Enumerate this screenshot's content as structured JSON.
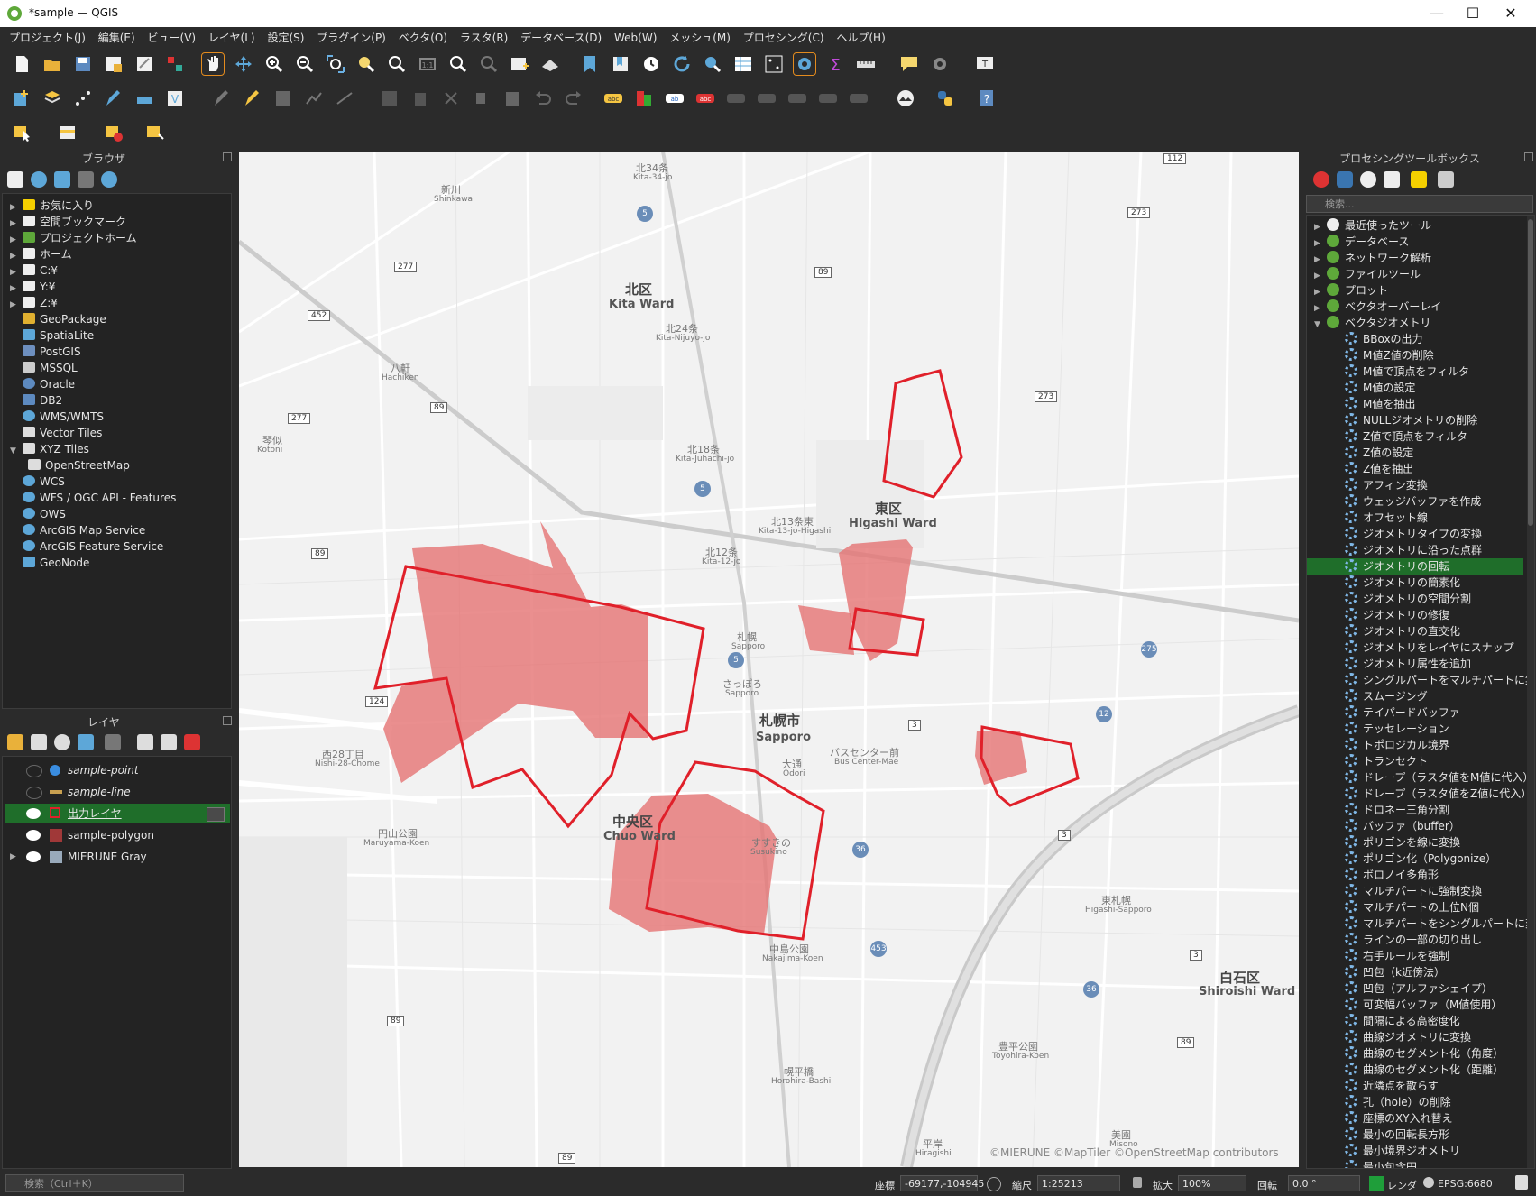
{
  "window": {
    "title": "*sample — QGIS"
  },
  "menu": [
    "プロジェクト(J)",
    "編集(E)",
    "ビュー(V)",
    "レイヤ(L)",
    "設定(S)",
    "プラグイン(P)",
    "ベクタ(O)",
    "ラスタ(R)",
    "データベース(D)",
    "Web(W)",
    "メッシュ(M)",
    "プロセシング(C)",
    "ヘルプ(H)"
  ],
  "browser": {
    "title": "ブラウザ",
    "items": [
      "お気に入り",
      "空間ブックマーク",
      "プロジェクトホーム",
      "ホーム",
      "C:¥",
      "Y:¥",
      "Z:¥",
      "GeoPackage",
      "SpatiaLite",
      "PostGIS",
      "MSSQL",
      "Oracle",
      "DB2",
      "WMS/WMTS",
      "Vector Tiles",
      "XYZ Tiles",
      "OpenStreetMap",
      "WCS",
      "WFS / OGC API - Features",
      "OWS",
      "ArcGIS Map Service",
      "ArcGIS Feature Service",
      "GeoNode"
    ]
  },
  "layers": {
    "title": "レイヤ",
    "items": [
      "sample-point",
      "sample-line",
      "出力レイヤ",
      "sample-polygon",
      "MIERUNE Gray"
    ]
  },
  "toolbox": {
    "title": "プロセシングツールボックス",
    "search_placeholder": "検索...",
    "groups": [
      "最近使ったツール",
      "データベース",
      "ネットワーク解析",
      "ファイルツール",
      "プロット",
      "ベクタオーバーレイ",
      "ベクタジオメトリ"
    ],
    "tools": [
      "BBoxの出力",
      "M値Z値の削除",
      "M値で頂点をフィルタ",
      "M値の設定",
      "M値を抽出",
      "NULLジオメトリの削除",
      "Z値で頂点をフィルタ",
      "Z値の設定",
      "Z値を抽出",
      "アフィン変換",
      "ウェッジバッファを作成",
      "オフセット線",
      "ジオメトリタイプの変換",
      "ジオメトリに沿った点群",
      "ジオメトリの回転",
      "ジオメトリの簡素化",
      "ジオメトリの空間分割",
      "ジオメトリの修復",
      "ジオメトリの直交化",
      "ジオメトリをレイヤにスナップ",
      "ジオメトリ属性を追加",
      "シングルパートをマルチパートに集約",
      "スムージング",
      "テイパードバッファ",
      "テッセレーション",
      "トポロジカル境界",
      "トランセクト",
      "ドレープ（ラスタ値をM値に代入）",
      "ドレープ（ラスタ値をZ値に代入）",
      "ドロネー三角分割",
      "バッファ（buffer）",
      "ポリゴンを線に変換",
      "ポリゴン化（Polygonize）",
      "ボロノイ多角形",
      "マルチパートに強制変換",
      "マルチパートの上位N個",
      "マルチパートをシングルパートに変換",
      "ラインの一部の切り出し",
      "右手ルールを強制",
      "凹包（k近傍法）",
      "凹包（アルファシェイプ）",
      "可変幅バッファ（M値使用）",
      "間隔による高密度化",
      "曲線ジオメトリに変換",
      "曲線のセグメント化（角度）",
      "曲線のセグメント化（距離）",
      "近隣点を散らす",
      "孔（hole）の削除",
      "座標のXY入れ替え",
      "最小の回転長方形",
      "最小境界ジオメトリ",
      "最小包含円"
    ],
    "selected_tool": "ジオメトリの回転"
  },
  "map": {
    "labels": {
      "kita": "北区",
      "kita_en": "Kita Ward",
      "higashi": "東区",
      "higashi_en": "Higashi Ward",
      "chuo": "中央区",
      "chuo_en": "Chuo Ward",
      "sapporo": "札幌市",
      "sapporo_en": "Sapporo",
      "shiroishi": "白石区",
      "shiroishi_en": "Shiroishi Ward",
      "kita34": "北34条",
      "kita34_en": "Kita-34-jo",
      "kita24": "北24条",
      "kita24_en": "Kita-Nijuyo-jo",
      "kita18": "北18条",
      "kita18_en": "Kita-Juhachi-jo",
      "kita13": "北13条東",
      "kita13_en": "Kita-13-jo-Higashi",
      "kita12": "北12条",
      "kita12_en": "Kita-12-jo",
      "sapporo_st": "札幌",
      "sapporo_st_en": "Sapporo",
      "satsuporo": "さっぽろ",
      "satsuporo_en": "Sapporo",
      "odori": "大通",
      "odori_en": "Odori",
      "bus": "バスセンター前",
      "bus_en": "Bus Center-Mae",
      "susukino": "すすきの",
      "susukino_en": "Susukino",
      "nakajima": "中島公園",
      "nakajima_en": "Nakajima-Koen",
      "horohira": "幌平橋",
      "horohira_en": "Horohira-Bashi",
      "nishi28": "西28丁目",
      "nishi28_en": "Nishi-28-Chome",
      "maruyama": "円山公園",
      "maruyama_en": "Maruyama-Koen",
      "hachiken": "八軒",
      "hachiken_en": "Hachiken",
      "kotoni": "琴似",
      "kotoni_en": "Kotoni",
      "shinkawa": "新川",
      "shinkawa_en": "Shinkawa",
      "higashisapporo": "東札幌",
      "higashisapporo_en": "Higashi-Sapporo",
      "toyohira": "豊平公園",
      "toyohira_en": "Toyohira-Koen",
      "misono": "美園",
      "misono_en": "Misono",
      "hiragishi": "平岸",
      "hiragishi_en": "Hiragishi"
    },
    "attribution": "©MIERUNE ©MapTiler ©OpenStreetMap contributors",
    "polygon_fill": "#e57373",
    "outline_color": "#e0202a"
  },
  "status": {
    "search_placeholder": "検索（Ctrl＋K）",
    "coord_label": "座標",
    "coord_value": "-69177,-104945",
    "scale_label": "縮尺",
    "scale_value": "1:25213",
    "magnifier_label": "拡大",
    "magnifier_value": "100%",
    "rotation_label": "回転",
    "rotation_value": "0.0 °",
    "render_label": "レンダ",
    "crs": "EPSG:6680"
  }
}
